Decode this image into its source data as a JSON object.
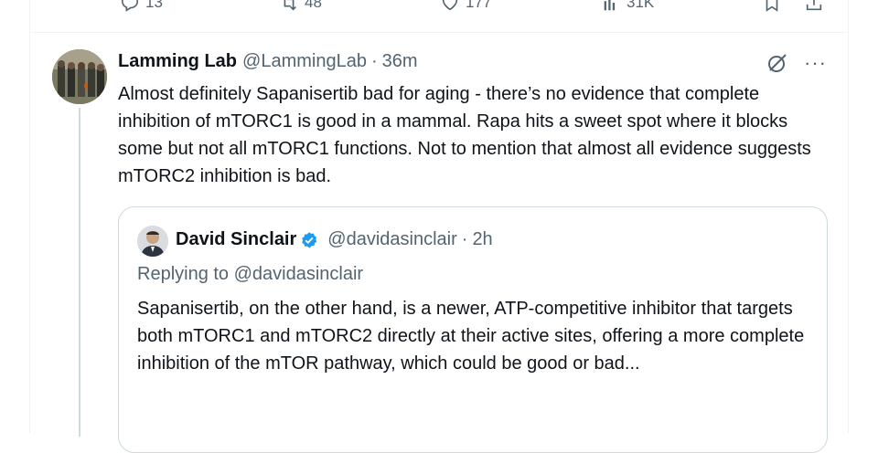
{
  "prev_actions": {
    "replies": "13",
    "reposts": "48",
    "likes": "177",
    "views": "31K"
  },
  "reply": {
    "name": "Lamming Lab",
    "handle": "@LammingLab",
    "dot": "·",
    "time": "36m",
    "more": "···",
    "text": "Almost definitely Sapanisertib bad for aging - there’s no evidence that complete inhibition of mTORC1 is good in a mammal. Rapa hits a sweet spot where it blocks some but not all mTORC1 functions. Not to mention that almost all evidence suggests mTORC2 inhibition is bad."
  },
  "quote": {
    "name": "David Sinclair",
    "handle": "@davidasinclair",
    "dot": "·",
    "time": "2h",
    "replying_to": "Replying to @davidasinclair",
    "text": "Sapanisertib, on the other hand, is a newer, ATP-competitive inhibitor that targets both mTORC1 and mTORC2 directly at their active sites, offering a more complete inhibition of the mTOR pathway, which could be good or bad..."
  },
  "colors": {
    "text": "#0f1419",
    "secondary": "#536471",
    "border": "#cfd9de",
    "verified": "#1d9bf0"
  },
  "icons": [
    "reply-icon",
    "repost-icon",
    "like-icon",
    "views-icon",
    "bookmark-icon",
    "share-icon",
    "grok-icon",
    "verified-badge-icon"
  ]
}
